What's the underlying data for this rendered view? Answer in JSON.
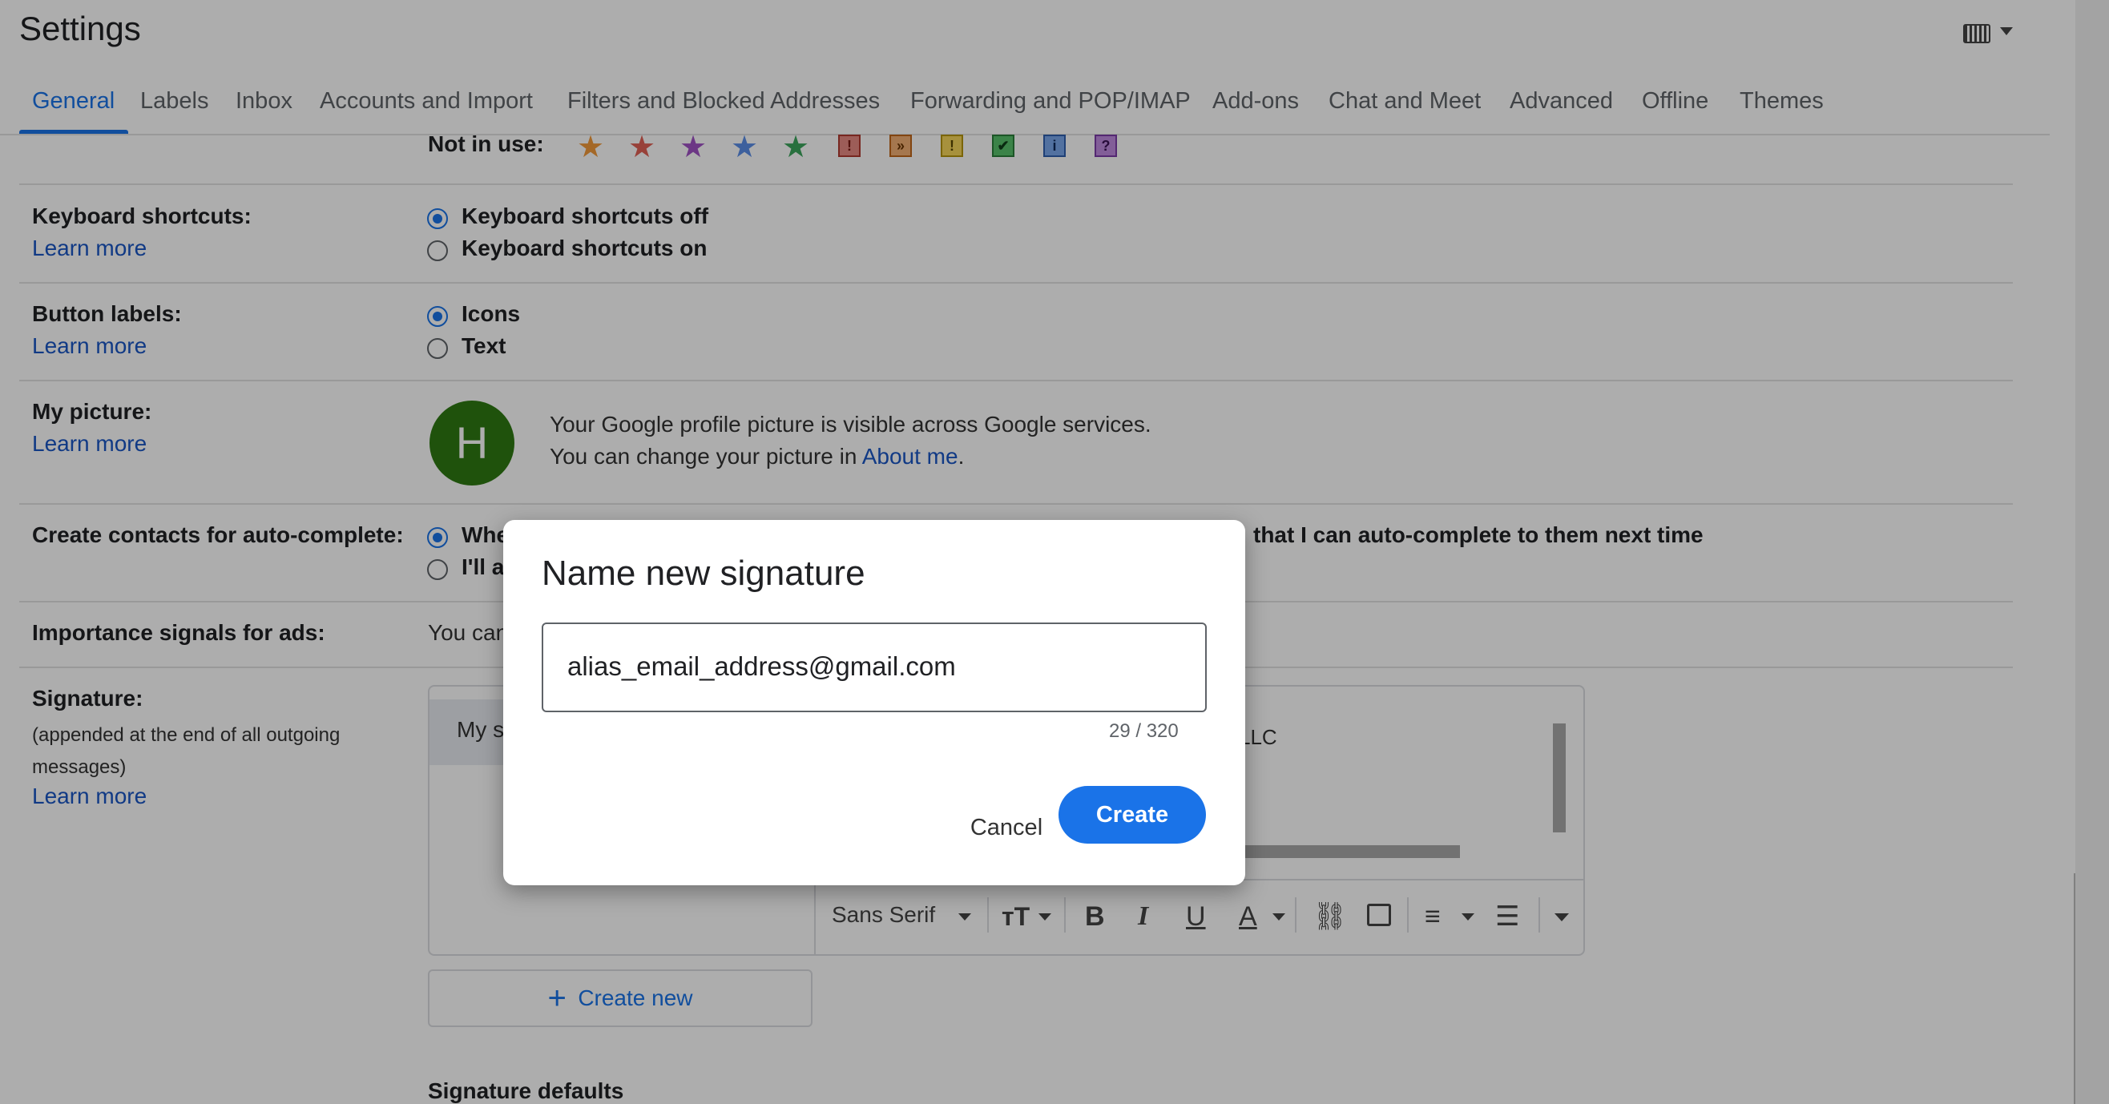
{
  "header": {
    "title": "Settings"
  },
  "tabs": [
    "General",
    "Labels",
    "Inbox",
    "Accounts and Import",
    "Filters and Blocked Addresses",
    "Forwarding and POP/IMAP",
    "Add-ons",
    "Chat and Meet",
    "Advanced",
    "Offline",
    "Themes"
  ],
  "stars": {
    "label": "Not in use:",
    "colors": {
      "orange": "#f29a3a",
      "red": "#e06055",
      "purple": "#a052c4",
      "blue": "#5a8ee8",
      "green": "#3ba55c"
    },
    "icons": [
      "orange-star",
      "red-star",
      "purple-star",
      "blue-star",
      "green-star",
      "red-bang",
      "orange-guillemet",
      "yellow-bang",
      "green-check",
      "blue-info",
      "purple-question"
    ],
    "glyphs": {
      "bang": "!",
      "guillemet": "»",
      "check": "✔",
      "info": "i",
      "question": "?"
    }
  },
  "keyboard": {
    "label": "Keyboard shortcuts:",
    "learn": "Learn more",
    "opt_off": "Keyboard shortcuts off",
    "opt_on": "Keyboard shortcuts on"
  },
  "buttons": {
    "label": "Button labels:",
    "learn": "Learn more",
    "opt_icons": "Icons",
    "opt_text": "Text"
  },
  "picture": {
    "label": "My picture:",
    "learn": "Learn more",
    "avatar_letter": "H",
    "line1": "Your Google profile picture is visible across Google services.",
    "line2_prefix": "You can change your picture in ",
    "line2_link": "About me",
    "line2_suffix": "."
  },
  "contacts": {
    "label": "Create contacts for auto-complete:",
    "opt1_visible": "Whe",
    "opt1_tail": "that I can auto-complete to them next time",
    "opt2_visible": "I'll a"
  },
  "importance": {
    "label": "Importance signals for ads:",
    "text_visible": "You can"
  },
  "signature": {
    "label": "Signature:",
    "desc": "(appended at the end of all outgoing messages)",
    "learn": "Learn more",
    "list_item_visible": "My s",
    "editor_visible": "LLC",
    "font_select": "Sans Serif",
    "create_new": "Create new",
    "defaults": "Signature defaults"
  },
  "dialog": {
    "title": "Name new signature",
    "input_value": "alias_email_address@gmail.com",
    "counter": "29 / 320",
    "cancel": "Cancel",
    "create": "Create",
    "accent": "#1a73e8"
  }
}
